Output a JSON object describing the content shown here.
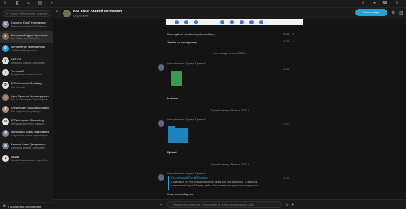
{
  "topbar": {
    "icons": [
      "layers-icon",
      "chat-icon",
      "monitor-icon",
      "folder-icon",
      "phone-icon",
      "search-icon",
      "bell-icon",
      "user-icon",
      "menu-icon"
    ]
  },
  "sidebar": {
    "search_placeholder": "Поиск (Обновление визит пр)",
    "chats": [
      {
        "name": "Соколов Юрий Николаевич",
        "preview": "Вызов пользователей Соколов",
        "initial": "С",
        "color": "#7b8a9a"
      },
      {
        "name": "Кахтимов Андрей Артемович",
        "preview": "Вы: Ответ на сообщение",
        "initial": "К",
        "color": "#8a6a4e",
        "active": true
      },
      {
        "name": "Обновление приложения (",
        "preview": "- In the sidebar you can...",
        "initial": "О",
        "color": "#2aa1d6"
      },
      {
        "name": "VKTATA",
        "preview": "Кахтимов Андрей Артемович...",
        "initial": "V",
        "color": "#e0e0e0"
      },
      {
        "name": "Тестовый",
        "preview": "Вы добавили Кахтимов Ан...",
        "initial": "Т",
        "color": "#e0e0e0"
      },
      {
        "name": "DT Workspace Roadmap",
        "preview": "Вы: test.xlsx",
        "initial": "D",
        "color": "#e0e0e0"
      },
      {
        "name": "Зуев Ярослав Александрович",
        "preview": "Вы: Ты написали Слава хорошо...",
        "initial": "З",
        "color": "#9a7a6a"
      },
      {
        "name": "Клейберину Оксана Михайловна",
        "preview": "Вы: подключены работу...",
        "initial": "К",
        "color": "#b08a7a"
      },
      {
        "name": "DT Workspace Discussing",
        "preview": "Обсуждение теперь открыто...",
        "initial": "D",
        "color": "#e0e0e0"
      },
      {
        "name": "Лисичкина Алина Николаевна",
        "preview": "Актуальная новая информация...",
        "initial": "Л",
        "color": "#8a7a9a"
      },
      {
        "name": "Бельков Иван Дмитриевич",
        "preview": "Кахтимов Андрей Артемович",
        "initial": "Б",
        "color": "#6a7a8a"
      },
      {
        "name": "aaaaa",
        "preview": "Ошибки неизвестной ли работы...",
        "initial": "a",
        "color": "#e0e0e0"
      }
    ],
    "footer_label": "Параметры приложения"
  },
  "header": {
    "title": "Кахтимов Андрей Артемович",
    "subtitle": "Отсутствует",
    "call_label": "Начать видео"
  },
  "messages": {
    "link_text": "https://github.com/kotaoryaka/text/file_it",
    "link_time": "16:38",
    "msg2_text": "Чтобы ни сотвергали)",
    "msg2_time": "16:38",
    "sep1": "пять назад, 8 июля 2022 г.",
    "m3_sender": "Оселобовский Сергей Юрьевич",
    "m3_time": "16:34",
    "m3_file": "test.xlsx",
    "sep2": "20 дней назад, 14 июля 2022 г.",
    "m4_sender": "Оселобовский Сергей Юрьевич",
    "m4_time": "13:01",
    "m4_file": "Upload",
    "sep3": "16 дней назад, 25 июля 2022 г.",
    "m5_sender": "Оселобовский Сергей Юрьевич",
    "m5_time": "16:22",
    "m5_quote_author": "Оселобовский Сергей Юрьевич",
    "m5_quote_line1": "Обнаружил, что при осевой/ной работе через мой этот заявление, В северном",
    "m5_quote_line2": "тематической через 3-7 может работ. После заявление нужно переопределите...",
    "m5_text": "Ответ на сообщение"
  },
  "composer": {
    "placeholder": "Напишите сообщение. Используй в @ чтобы упомянуть кого-либо..."
  }
}
